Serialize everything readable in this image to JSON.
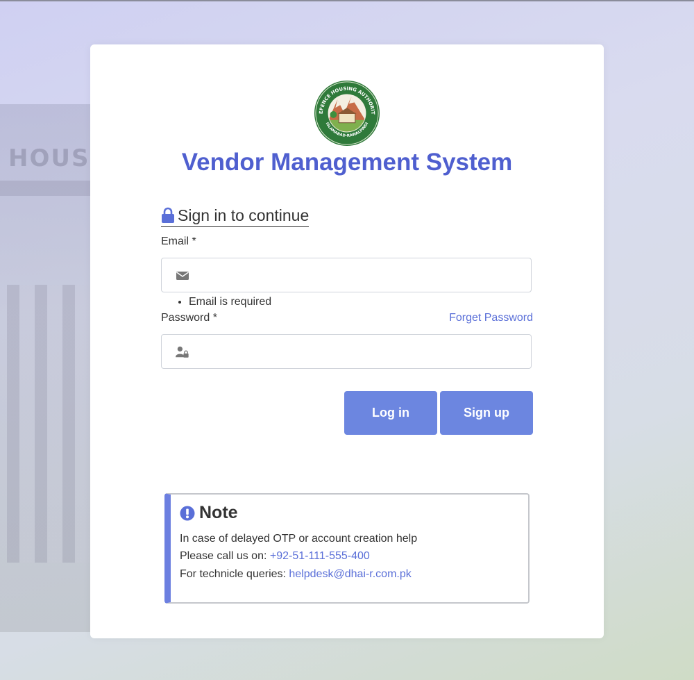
{
  "background": {
    "sign_text": "HOUSIN"
  },
  "logo": {
    "top_text": "DEFENCE HOUSING AUTHORITY",
    "bottom_text": "ISLAMABAD-RAWALPINDI"
  },
  "app_title": "Vendor Management System",
  "signin": {
    "heading": "Sign in to continue",
    "lock_icon": "lock-icon"
  },
  "email": {
    "label": "Email *",
    "value": "",
    "icon": "envelope-icon",
    "error": "Email is required"
  },
  "password": {
    "label": "Password *",
    "value": "",
    "icon": "user-lock-icon",
    "forget_label": "Forget Password"
  },
  "buttons": {
    "login_label": "Log in",
    "signup_label": "Sign up"
  },
  "note": {
    "title": "Note",
    "line1": "In case of delayed OTP or account creation help",
    "line2_prefix": "Please call us on: ",
    "phone": "+92-51-111-555-400",
    "line3_prefix": "For technicle queries: ",
    "email": "helpdesk@dhai-r.com.pk"
  },
  "colors": {
    "accent": "#4f5fcf",
    "button": "#6c86e0",
    "link": "#5a6fd8",
    "note_border": "#6c7fe0"
  }
}
